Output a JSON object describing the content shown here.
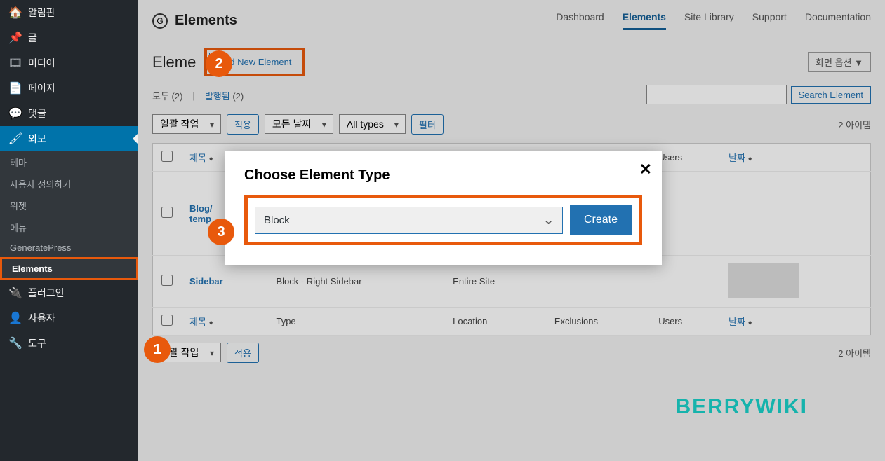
{
  "sidebar": {
    "items": [
      {
        "icon": "🏠",
        "label": "알림판"
      },
      {
        "icon": "📌",
        "label": "글"
      },
      {
        "icon": "🎞",
        "label": "미디어"
      },
      {
        "icon": "📄",
        "label": "페이지"
      },
      {
        "icon": "💬",
        "label": "댓글"
      },
      {
        "icon": "🖌",
        "label": "외모"
      },
      {
        "icon": "🔌",
        "label": "플러그인"
      },
      {
        "icon": "👤",
        "label": "사용자"
      },
      {
        "icon": "🔧",
        "label": "도구"
      }
    ],
    "appearance_sub": [
      "테마",
      "사용자 정의하기",
      "위젯",
      "메뉴",
      "GeneratePress",
      "Elements"
    ]
  },
  "topbar": {
    "title": "Elements",
    "nav": [
      "Dashboard",
      "Elements",
      "Site Library",
      "Support",
      "Documentation"
    ]
  },
  "head": {
    "page_title": "Eleme",
    "add_new": "Add New Element",
    "screen_options": "화면 옵션 ▼"
  },
  "filter": {
    "all_label": "모두",
    "all_count": "(2)",
    "sep": "|",
    "pub_label": "발행됨",
    "pub_count": "(2)"
  },
  "search": {
    "btn": "Search Element"
  },
  "controls": {
    "bulk": "일괄 작업",
    "apply": "적용",
    "dates": "모든 날짜",
    "types": "All types",
    "filter_btn": "필터",
    "items_count": "2 아이템"
  },
  "table": {
    "cols": {
      "title": "제목",
      "type": "Type",
      "location": "Location",
      "exclusions": "Exclusions",
      "users": "Users",
      "date": "날짜"
    },
    "rows": [
      {
        "title": "Blog/\ntemp",
        "type": "",
        "location": "",
        "exclusions": "",
        "users": "",
        "thumb": false
      },
      {
        "title": "Sidebar",
        "type": "Block - Right Sidebar",
        "location": "Entire Site",
        "exclusions": "",
        "users": "",
        "thumb": true
      }
    ]
  },
  "modal": {
    "title": "Choose Element Type",
    "select_value": "Block",
    "create": "Create"
  },
  "annotations": {
    "a1": "1",
    "a2": "2",
    "a3": "3"
  },
  "watermark": "BERRYWIKI"
}
